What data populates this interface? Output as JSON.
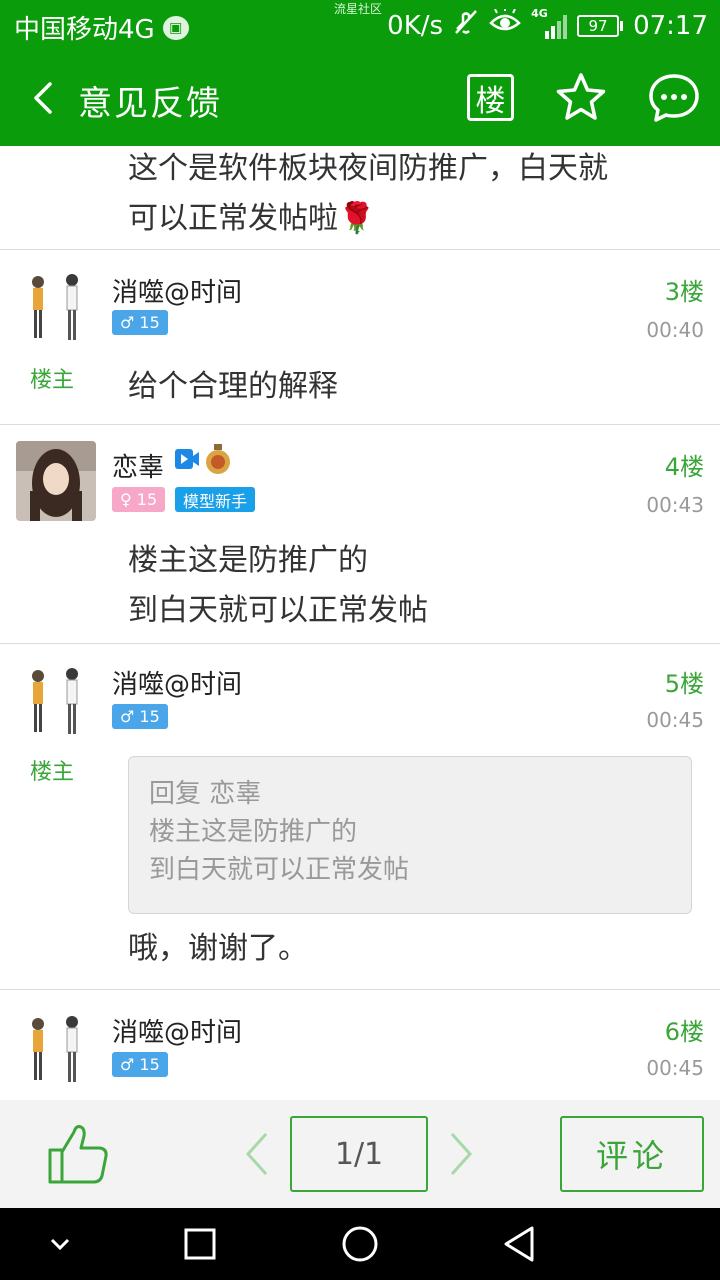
{
  "status_bar": {
    "carrier": "中国移动4G",
    "center_label": "流星社区",
    "net_speed": "0K/s",
    "network_type": "4G",
    "battery": "97",
    "time": "07:17"
  },
  "header": {
    "title": "意见反馈",
    "floor_button_label": "楼"
  },
  "posts": [
    {
      "body": [
        "这个是软件板块夜间防推广，白天就",
        "可以正常发帖啦🌹"
      ]
    },
    {
      "username": "消噬@时间",
      "gender_badge": "♂ 15",
      "floor": "3楼",
      "time": "00:40",
      "owner_tag": "楼主",
      "body": [
        "给个合理的解释"
      ]
    },
    {
      "username": "恋辜",
      "gender_badge": "♀ 15",
      "level_badge": "模型新手",
      "floor": "4楼",
      "time": "00:43",
      "body": [
        "楼主这是防推广的",
        "到白天就可以正常发帖"
      ]
    },
    {
      "username": "消噬@时间",
      "gender_badge": "♂ 15",
      "floor": "5楼",
      "time": "00:45",
      "owner_tag": "楼主",
      "quote": [
        "回复 恋辜",
        "楼主这是防推广的",
        "到白天就可以正常发帖"
      ],
      "body": [
        "哦，谢谢了。"
      ]
    },
    {
      "username": "消噬@时间",
      "gender_badge": "♂ 15",
      "floor": "6楼",
      "time": "00:45"
    }
  ],
  "action_bar": {
    "page_indicator": "1/1",
    "comment_label": "评论"
  },
  "colors": {
    "brand_green": "#0b9c0b",
    "accent_green": "#3aa63a"
  }
}
